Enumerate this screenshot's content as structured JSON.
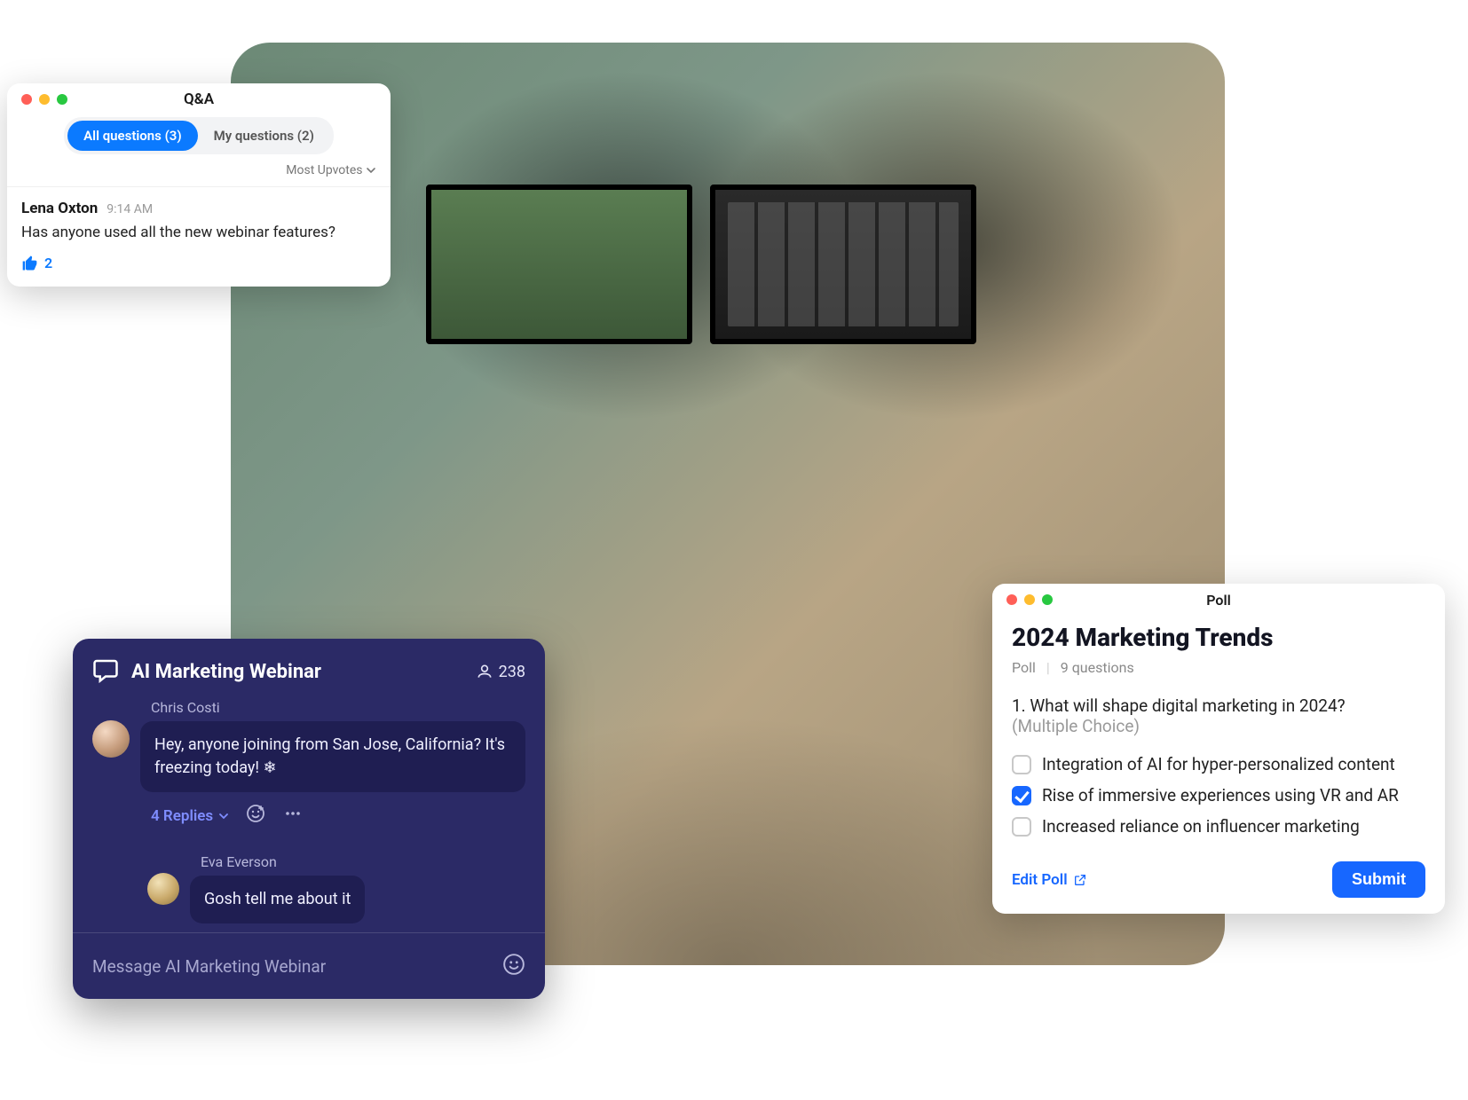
{
  "qa": {
    "title": "Q&A",
    "tabs": {
      "all": "All questions (3)",
      "mine": "My questions (2)"
    },
    "sort_label": "Most Upvotes",
    "question": {
      "author": "Lena Oxton",
      "time": "9:14 AM",
      "text": "Has anyone used all the new webinar features?",
      "likes": "2"
    }
  },
  "chat": {
    "title": "AI Marketing Webinar",
    "count": "238",
    "messages": [
      {
        "author": "Chris Costi",
        "text": "Hey, anyone joining from San Jose, California? It's freezing today! ❄"
      },
      {
        "author": "Eva Everson",
        "text": "Gosh tell me about it"
      }
    ],
    "replies_label": "4 Replies",
    "input_placeholder": "Message AI Marketing Webinar"
  },
  "poll": {
    "window_title": "Poll",
    "title": "2024 Marketing Trends",
    "sub_label": "Poll",
    "sub_count": "9 questions",
    "question_number": "1.",
    "question": "What will shape digital marketing in 2024?",
    "hint": "(Multiple Choice)",
    "options": [
      {
        "label": "Integration of AI for hyper-personalized content",
        "checked": false
      },
      {
        "label": "Rise of immersive experiences using VR and AR",
        "checked": true
      },
      {
        "label": "Increased reliance on influencer marketing",
        "checked": false
      }
    ],
    "edit_label": "Edit Poll",
    "submit_label": "Submit"
  }
}
